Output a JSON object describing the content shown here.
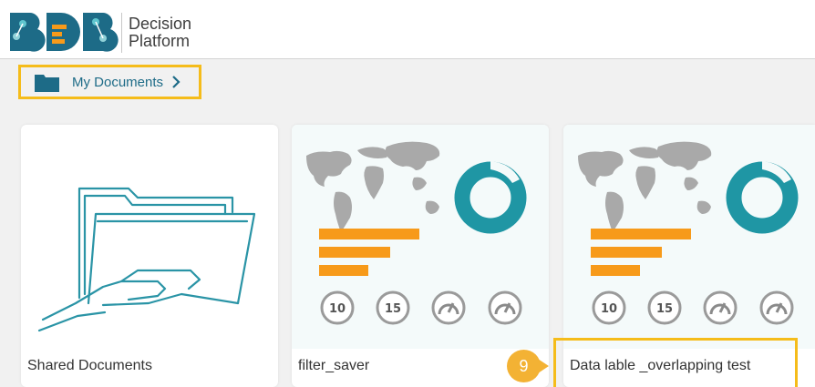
{
  "header": {
    "brand_line1": "Decision",
    "brand_line2": "Platform"
  },
  "breadcrumb": {
    "label": "My Documents",
    "icon": "folder-icon"
  },
  "cards": [
    {
      "name": "Shared Documents",
      "kind": "folder"
    },
    {
      "name": "filter_saver",
      "kind": "dashboard"
    },
    {
      "name": "Data lable _overlapping test",
      "kind": "dashboard"
    }
  ],
  "thumbnail": {
    "gauge_1": "10",
    "gauge_2": "15"
  },
  "callout": {
    "step": "9"
  },
  "colors": {
    "accent": "#f5bc1a",
    "teal": "#1f96a4",
    "orange": "#f79a1a",
    "link": "#1d6b87"
  }
}
